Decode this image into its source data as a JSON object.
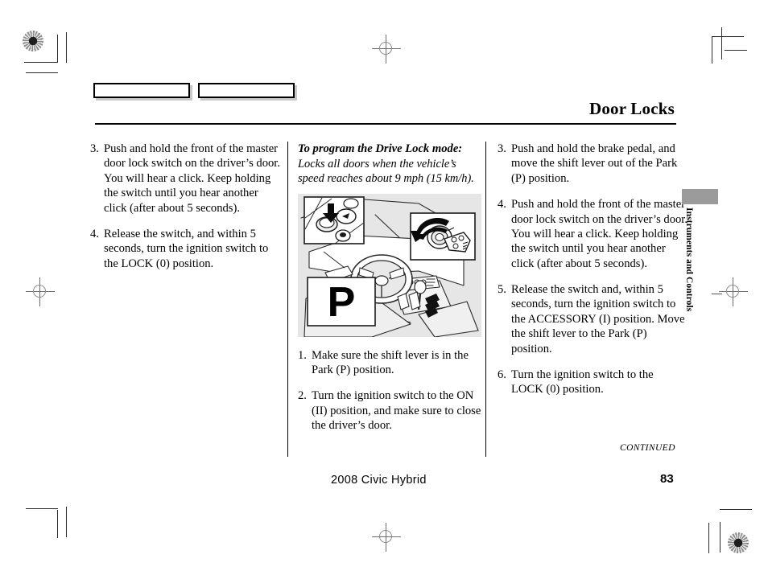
{
  "page": {
    "header_title": "Door Locks",
    "footer_model": "2008  Civic  Hybrid",
    "page_number": "83",
    "continued_label": "CONTINUED",
    "side_tab_label": "Instruments and Controls"
  },
  "left_column": {
    "steps": [
      {
        "num": "3.",
        "text": "Push and hold the front of the master door lock switch on the driver’s door. You will hear a click. Keep holding the switch until you hear another click (after about 5 seconds)."
      },
      {
        "num": "4.",
        "text": "Release the switch, and within 5 seconds, turn the ignition switch to the LOCK (0) position."
      }
    ]
  },
  "middle_column": {
    "subhead": "To program the Drive Lock mode:",
    "subtext": "Locks all doors when the vehicle’s speed reaches about 9 mph (15 km/h).",
    "figure": {
      "alt": "car-interior-illustration",
      "shift_label": "P",
      "inset_door_lock_switch": "door-lock-switch-inset",
      "inset_ignition_key": "ignition-key-inset"
    },
    "steps": [
      {
        "num": "1.",
        "text": "Make sure the shift lever is in the Park (P) position."
      },
      {
        "num": "2.",
        "text": "Turn the ignition switch to the ON (II) position, and make sure to close the driver’s door."
      }
    ]
  },
  "right_column": {
    "steps": [
      {
        "num": "3.",
        "text": "Push and hold the brake pedal, and move the shift lever out of the Park (P) position."
      },
      {
        "num": "4.",
        "text": "Push and hold the front of the master door lock switch on the driver’s door. You will hear a click. Keep holding the switch until you hear another click (after about 5 seconds)."
      },
      {
        "num": "5.",
        "text": "Release the switch and, within 5 seconds, turn the ignition switch to the ACCESSORY (I) position. Move the shift lever to the Park (P) position."
      },
      {
        "num": "6.",
        "text": "Turn the ignition switch to the LOCK (0) position."
      }
    ]
  },
  "print_marks": {
    "tag_boxes": [
      "",
      ""
    ],
    "registration_targets": 2,
    "registration_crosses": 4
  }
}
